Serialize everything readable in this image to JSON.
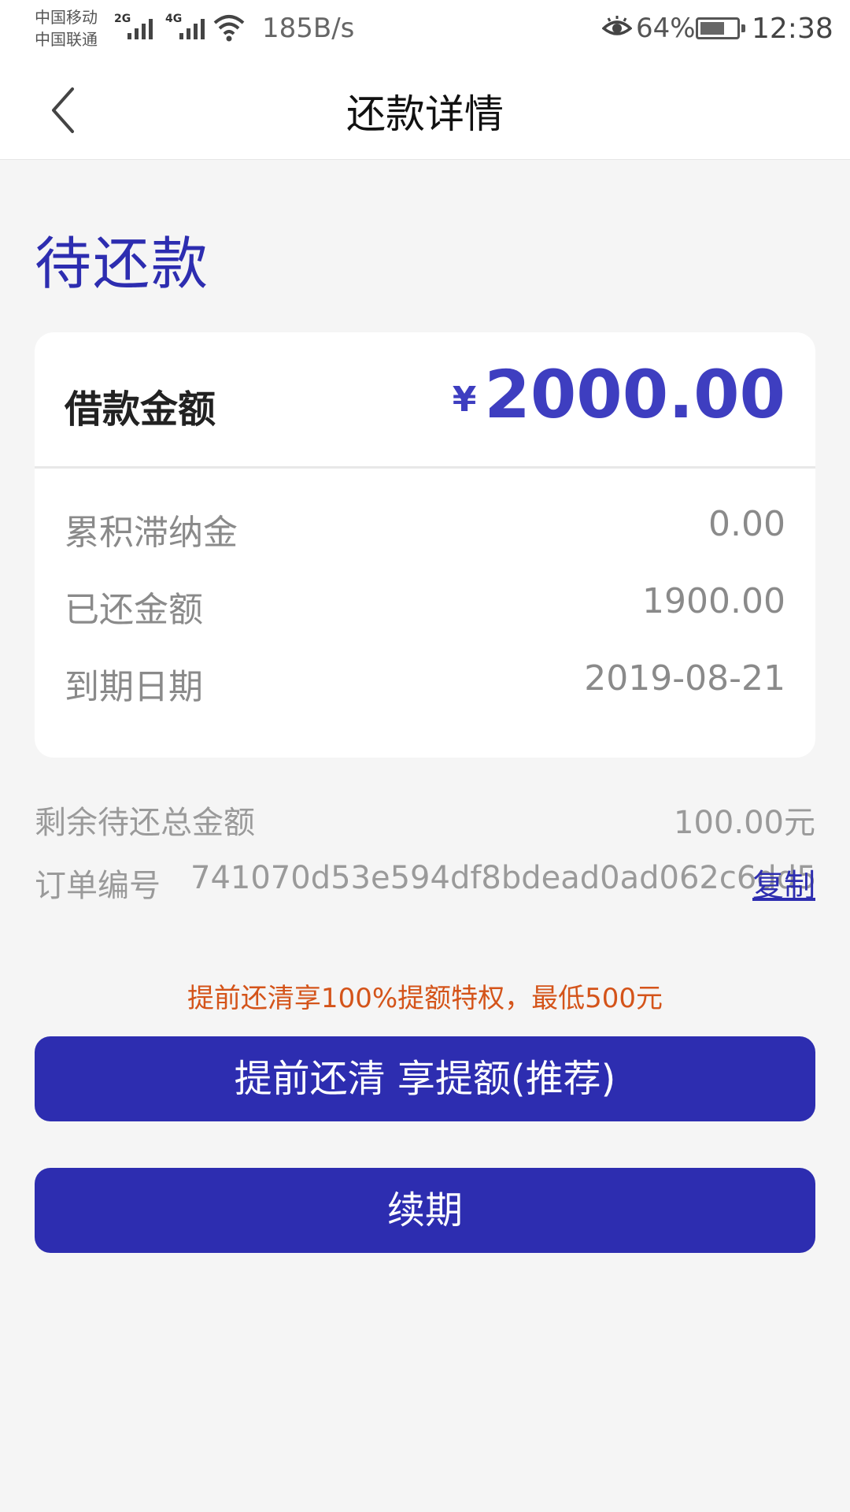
{
  "status_bar": {
    "carrier_1": "中国移动",
    "carrier_2": "中国联通",
    "net_1": "2G",
    "net_2": "4G",
    "speed": "185B/s",
    "battery": "64%",
    "time": "12:38"
  },
  "nav": {
    "title": "还款详情",
    "back_icon": "chevron-left-icon"
  },
  "status_heading": "待还款",
  "card": {
    "loan_label": "借款金额",
    "currency": "¥",
    "loan_amount": "2000.00",
    "rows": [
      {
        "label": "累积滞纳金",
        "value": "0.00"
      },
      {
        "label": "已还金额",
        "value": "1900.00"
      },
      {
        "label": "到期日期",
        "value": "2019-08-21"
      }
    ]
  },
  "remaining": {
    "label": "剩余待还总金额",
    "value": "100.00元"
  },
  "order": {
    "label": "订单编号",
    "number": "741070d53e594df8bdead0ad062c6dd5",
    "copy_label": "复制"
  },
  "promo": "提前还清享100%提额特权，最低500元",
  "buttons": {
    "payoff": "提前还清 享提额(推荐)",
    "renew": "续期"
  },
  "colors": {
    "accent": "#2d2db0",
    "amount": "#3e3ec0",
    "promo": "#d4541a",
    "background": "#f5f5f5"
  }
}
